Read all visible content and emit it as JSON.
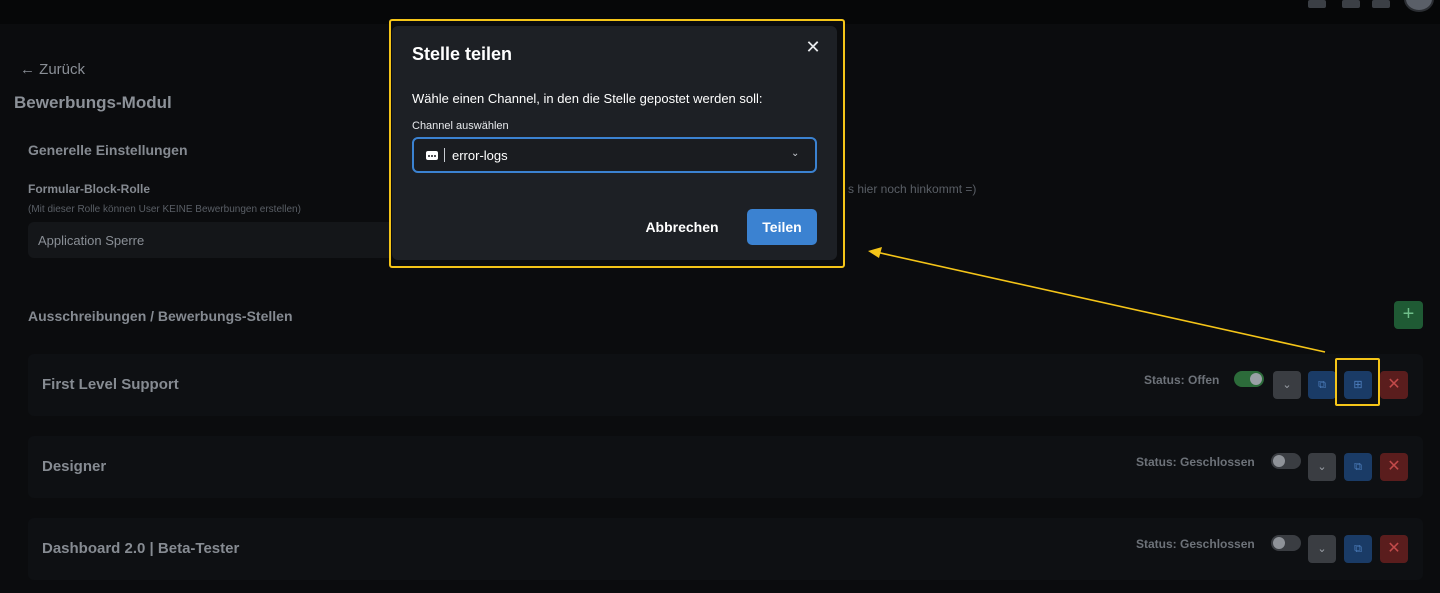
{
  "topbar": {
    "icons": [
      "person-icon",
      "mail-icon",
      "bell-icon"
    ],
    "avatar": "user-avatar"
  },
  "page": {
    "back_label": "← Zurück",
    "title": "Bewerbungs-Modul",
    "general": {
      "heading": "Generelle Einstellungen",
      "field_label": "Formular-Block-Rolle",
      "field_hint": "(Mit dieser Rolle können User KEINE Bewerbungen erstellen)",
      "field_value": "Application Sperre",
      "right_hint": "s hier noch hinkommt =)"
    },
    "jobs": {
      "heading": "Ausschreibungen / Bewerbungs-Stellen",
      "add_label": "+",
      "items": [
        {
          "title": "First Level Support",
          "status": "Status: Offen",
          "open": true
        },
        {
          "title": "Designer",
          "status": "Status: Geschlossen",
          "open": false
        },
        {
          "title": "Dashboard 2.0 | Beta-Tester",
          "status": "Status: Geschlossen",
          "open": false
        }
      ]
    }
  },
  "modal": {
    "title": "Stelle teilen",
    "close_label": "✕",
    "description": "Wähle einen Channel, in den die Stelle gepostet werden soll:",
    "channel_label": "Channel auswählen",
    "channel_value": "error-logs",
    "cancel_label": "Abbrechen",
    "share_label": "Teilen"
  },
  "colors": {
    "accent": "#3b82d1",
    "highlight": "#f5c518",
    "success": "#2c6b3a",
    "danger": "#5a1d1d"
  }
}
